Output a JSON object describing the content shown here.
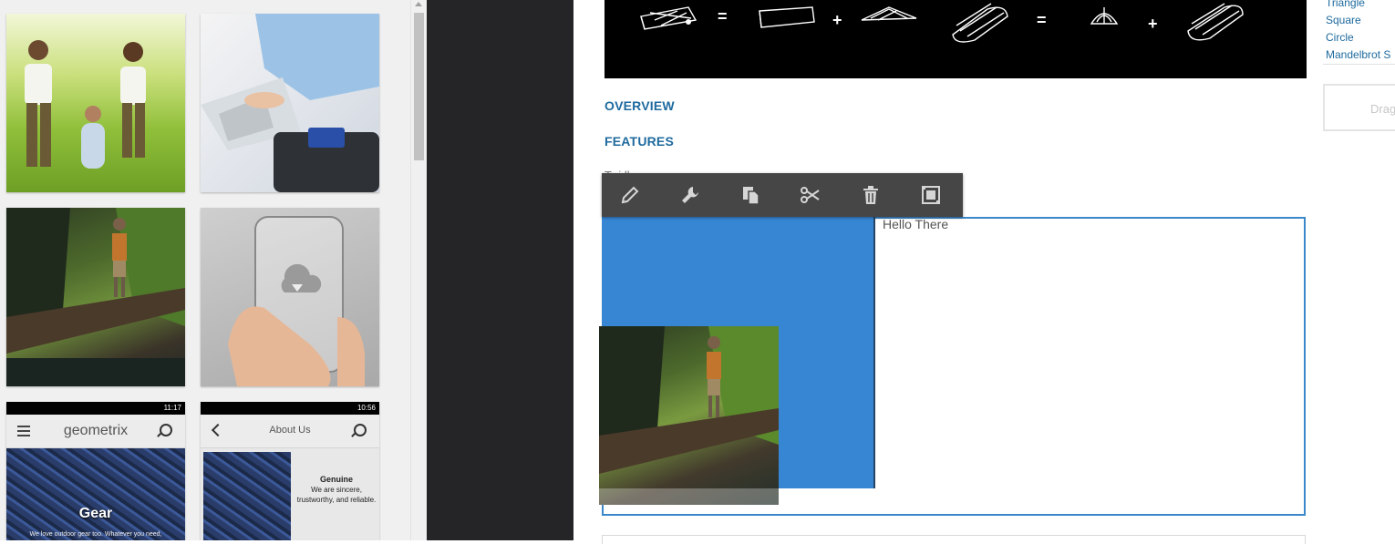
{
  "asset_panel": {
    "thumbs": [
      {
        "name": "family-in-meadow-image"
      },
      {
        "name": "laptop-typing-image"
      },
      {
        "name": "hiker-on-log-image"
      },
      {
        "name": "transparent-phone-image"
      }
    ],
    "mobile_1": {
      "status_time": "11:17",
      "title": "geometrix",
      "hero_label": "Gear",
      "hero_sub": "We love outdoor gear too. Whatever you need,"
    },
    "mobile_2": {
      "status_time": "10:56",
      "title": "About Us",
      "genuine_title": "Genuine",
      "genuine_body": "We are sincere, trustworthy, and reliable."
    }
  },
  "page": {
    "nav": {
      "overview": "OVERVIEW",
      "features": "FEATURES"
    },
    "hidden_text": "Tr i ll",
    "text_component": "Hello There",
    "toolbar": {
      "edit": "pencil-icon",
      "configure": "wrench-icon",
      "copy": "copy-icon",
      "cut": "scissors-icon",
      "delete": "trash-icon",
      "group": "group-icon"
    }
  },
  "side_panel": {
    "links": [
      "Triangle",
      "Square",
      "Circle",
      "Mandelbrot S"
    ],
    "drag_text": "Drag"
  },
  "colors": {
    "accent_link": "#1e6a9e",
    "selection_border": "#3a87c9",
    "blue_block": "#3686d4",
    "toolbar_bg": "#464646",
    "gutter": "#252528"
  }
}
